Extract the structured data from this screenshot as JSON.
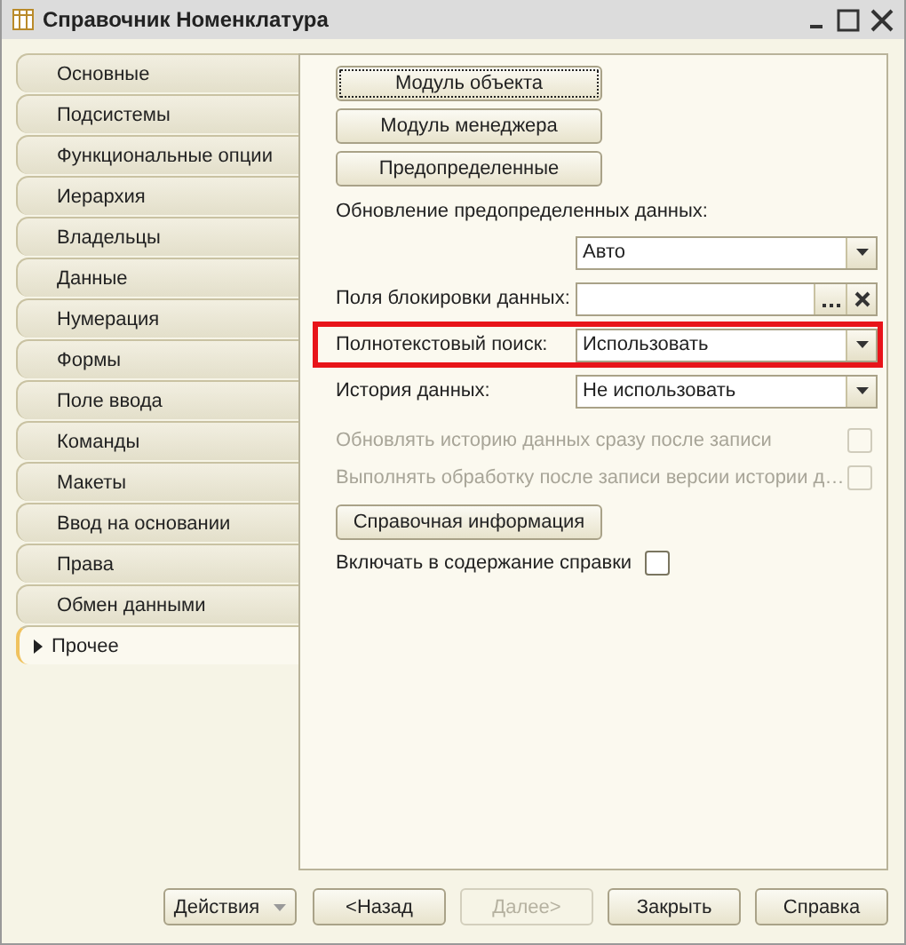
{
  "window": {
    "title": "Справочник Номенклатура"
  },
  "tabs": [
    {
      "label": "Основные",
      "selected": false
    },
    {
      "label": "Подсистемы",
      "selected": false
    },
    {
      "label": "Функциональные опции",
      "selected": false
    },
    {
      "label": "Иерархия",
      "selected": false
    },
    {
      "label": "Владельцы",
      "selected": false
    },
    {
      "label": "Данные",
      "selected": false
    },
    {
      "label": "Нумерация",
      "selected": false
    },
    {
      "label": "Формы",
      "selected": false
    },
    {
      "label": "Поле ввода",
      "selected": false
    },
    {
      "label": "Команды",
      "selected": false
    },
    {
      "label": "Макеты",
      "selected": false
    },
    {
      "label": "Ввод на основании",
      "selected": false
    },
    {
      "label": "Права",
      "selected": false
    },
    {
      "label": "Обмен данными",
      "selected": false
    },
    {
      "label": "Прочее",
      "selected": true
    }
  ],
  "content": [
    {
      "kind": "button",
      "label": "Модуль объекта",
      "focused": true
    },
    {
      "kind": "button",
      "label": "Модуль менеджера",
      "focused": false
    },
    {
      "kind": "button",
      "label": "Предопределенные",
      "focused": false
    },
    {
      "kind": "caption",
      "text": "Обновление предопределенных данных:"
    },
    {
      "kind": "select",
      "value": "Авто",
      "highlighted": false
    },
    {
      "kind": "choice",
      "label": "Поля блокировки данных:",
      "highlighted": false
    },
    {
      "kind": "select",
      "label": "Полнотекстовый поиск:",
      "value": "Использовать",
      "highlighted": true
    },
    {
      "kind": "select",
      "label": "История данных:",
      "value": "Не использовать",
      "highlighted": false
    },
    {
      "kind": "checkbox",
      "label": "Обновлять историю данных сразу после записи",
      "checked": false,
      "disabled": true
    },
    {
      "kind": "checkbox",
      "label": "Выполнять обработку после записи версии истории д…",
      "checked": false,
      "disabled": true
    },
    {
      "kind": "button",
      "label": "Справочная информация",
      "focused": false
    },
    {
      "kind": "inline-checkbox",
      "label": "Включать в содержание справки",
      "checked": false,
      "disabled": false
    }
  ],
  "footer": [
    {
      "kind": "menu",
      "label": "Действия",
      "disabled": false
    },
    {
      "kind": "button",
      "label": "<Назад",
      "disabled": false
    },
    {
      "kind": "button",
      "label": "Далее>",
      "disabled": true
    },
    {
      "kind": "button",
      "label": "Закрыть",
      "disabled": false
    },
    {
      "kind": "button",
      "label": "Справка",
      "disabled": false
    }
  ]
}
